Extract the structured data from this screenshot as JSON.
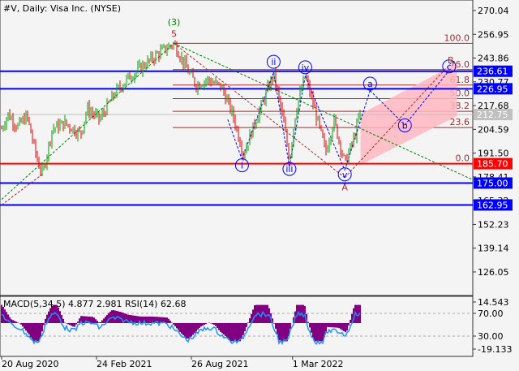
{
  "title": "#V, Daily:  Visa Inc. (NYSE)",
  "indicator_label": "MACD(5,34,5) 4.877 2.981 RSI(14) 62.68",
  "colors": {
    "bull": "#00a000",
    "bear": "#e00000",
    "blue": "#0000ff",
    "red": "#ff0000",
    "fib": "#a52a2a",
    "channel": "#ffb6c1",
    "macd": "#800080",
    "rsi": "#1e90ff"
  },
  "chart_data": {
    "type": "candlestick",
    "title": "#V, Daily:  Visa Inc. (NYSE)",
    "ylim": [
      121,
      275
    ],
    "y_ticks": [
      "270.04",
      "256.95",
      "243.86",
      "230.77",
      "217.68",
      "204.59",
      "191.50",
      "178.41",
      "165.32",
      "152.23",
      "139.14",
      "126.05"
    ],
    "y_tick_values": [
      270.04,
      256.95,
      243.86,
      230.77,
      217.68,
      204.59,
      191.5,
      178.41,
      165.32,
      152.23,
      139.14,
      126.05
    ],
    "x_labels": [
      "20 Aug 2020",
      "24 Feb 2021",
      "26 Aug 2021",
      "1 Mar 2022"
    ],
    "x_label_months": [
      0,
      6,
      12,
      18.4
    ],
    "xlim_months": [
      0,
      30
    ],
    "price_path_months_price": [
      [
        0,
        205
      ],
      [
        0.4,
        213
      ],
      [
        1,
        206
      ],
      [
        1.6,
        212
      ],
      [
        2.3,
        186
      ],
      [
        2.6,
        180
      ],
      [
        3.2,
        205
      ],
      [
        4,
        208
      ],
      [
        5,
        202
      ],
      [
        5.4,
        216
      ],
      [
        6.2,
        210
      ],
      [
        7.2,
        225
      ],
      [
        8,
        233
      ],
      [
        9,
        240
      ],
      [
        10,
        247
      ],
      [
        10.9,
        252
      ],
      [
        11.7,
        238
      ],
      [
        12.3,
        229
      ],
      [
        13,
        232
      ],
      [
        13.9,
        228
      ],
      [
        14.6,
        213
      ],
      [
        15.3,
        191
      ],
      [
        16,
        208
      ],
      [
        17.2,
        235
      ],
      [
        17.8,
        210
      ],
      [
        18.2,
        188
      ],
      [
        18.6,
        215
      ],
      [
        19.2,
        234
      ],
      [
        19.8,
        215
      ],
      [
        20.5,
        192
      ],
      [
        21,
        210
      ],
      [
        21.7,
        186
      ],
      [
        22.3,
        200
      ],
      [
        22.7,
        215
      ]
    ],
    "horizontal_levels": [
      {
        "value": 236.61,
        "label": "236.61",
        "color": "#0000ff"
      },
      {
        "value": 226.95,
        "label": "226.95",
        "color": "#0000ff"
      },
      {
        "value": 185.7,
        "label": "185.70",
        "color": "#ff0000"
      },
      {
        "value": 175.0,
        "label": "175.00",
        "color": "#0000ff"
      },
      {
        "value": 162.95,
        "label": "162.95",
        "color": "#0000ff"
      }
    ],
    "current_price": {
      "value": 212.75,
      "label": "212.75"
    },
    "fibonacci": [
      {
        "level": "100.0",
        "price": 252.0
      },
      {
        "level": "76.0",
        "price": 237.5
      },
      {
        "level": "61.8",
        "price": 229.0
      },
      {
        "level": "50.0",
        "price": 221.5
      },
      {
        "level": "38.2",
        "price": 214.5
      },
      {
        "level": "23.6",
        "price": 205.6
      },
      {
        "level": "0.0",
        "price": 185.7
      }
    ],
    "wave_labels": [
      {
        "text": "(3)",
        "m": 10.9,
        "p": 262,
        "color": "#008000",
        "circle": false
      },
      {
        "text": "5",
        "m": 10.9,
        "p": 255.5,
        "color": "#a52a2a",
        "circle": false
      },
      {
        "text": "i",
        "m": 15.2,
        "p": 183,
        "color": "#0000ff",
        "circle": true
      },
      {
        "text": "ii",
        "m": 17.2,
        "p": 240,
        "color": "#0000ff",
        "circle": true
      },
      {
        "text": "iii",
        "m": 18.2,
        "p": 181,
        "color": "#0000ff",
        "circle": true
      },
      {
        "text": "iv",
        "m": 19.2,
        "p": 237,
        "color": "#0000ff",
        "circle": true
      },
      {
        "text": "v",
        "m": 21.7,
        "p": 178,
        "color": "#0000ff",
        "circle": true
      },
      {
        "text": "A",
        "m": 21.7,
        "p": 171,
        "color": "#a52a2a",
        "circle": false
      },
      {
        "text": "a",
        "m": 23.3,
        "p": 228,
        "color": "#0000ff",
        "circle": true
      },
      {
        "text": "b",
        "m": 25.5,
        "p": 205,
        "color": "#0000ff",
        "circle": true
      },
      {
        "text": "c",
        "m": 28.3,
        "p": 237.5,
        "color": "#0000ff",
        "circle": true
      },
      {
        "text": "B",
        "m": 28.4,
        "p": 241,
        "color": "#a52a2a",
        "circle": false
      }
    ],
    "indicator": {
      "name": "MACD/RSI",
      "ylim": [
        -19.133,
        14.543
      ],
      "y_ticks": [
        "14.543",
        "70.00",
        "30.00",
        "-19.133"
      ],
      "macd": 4.877,
      "signal": 2.981,
      "rsi": 62.68
    }
  }
}
